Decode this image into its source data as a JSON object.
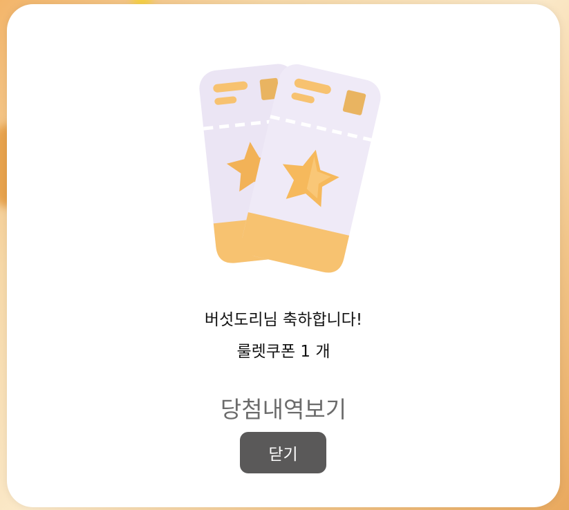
{
  "dialog": {
    "title": "버섯도리님 축하합니다!",
    "reward": "룰렛쿠폰 1 개",
    "history_link": "당첨내역보기",
    "close_label": "닫기"
  },
  "illustration": {
    "icon": "coupon-tickets-icon",
    "colors": {
      "ticket": "#efeaf7",
      "accent": "#f7c270",
      "star": "#f6b95c"
    }
  },
  "colors": {
    "button_bg": "#5a5959",
    "button_text": "#ffffff",
    "link_text": "#6b6b6b",
    "body_text": "#111111"
  }
}
